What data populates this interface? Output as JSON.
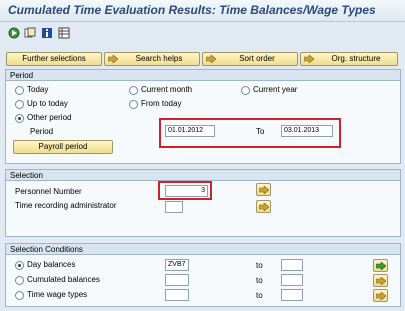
{
  "title": "Cumulated Time Evaluation Results: Time Balances/Wage Types",
  "toolbar": {
    "icons": [
      "execute-icon",
      "variant-icon",
      "info-icon",
      "layout-icon"
    ],
    "buttons": [
      {
        "label": "Further selections"
      },
      {
        "label": "Search helps"
      },
      {
        "label": "Sort order"
      },
      {
        "label": "Org. structure"
      }
    ]
  },
  "period": {
    "header": "Period",
    "options": {
      "today": "Today",
      "current_month": "Current month",
      "current_year": "Current year",
      "up_to_today": "Up to today",
      "from_today": "From today",
      "other_period": "Other period"
    },
    "selected": "other_period",
    "period_label": "Period",
    "from_date": "01.01.2012",
    "to_label": "To",
    "to_date": "03.01.2013",
    "payroll_button": "Payroll period"
  },
  "selection": {
    "header": "Selection",
    "personnel_label": "Personnel Number",
    "personnel_value": "3",
    "time_admin_label": "Time recording administrator",
    "time_admin_value": ""
  },
  "conditions": {
    "header": "Selection Conditions",
    "rows": [
      {
        "label": "Day balances",
        "value": "ZVB7",
        "to_label": "to",
        "to_value": "",
        "selected": true
      },
      {
        "label": "Cumulated balances",
        "value": "",
        "to_label": "to",
        "to_value": "",
        "selected": false
      },
      {
        "label": "Time wage types",
        "value": "",
        "to_label": "to",
        "to_value": "",
        "selected": false
      }
    ]
  },
  "colors": {
    "accent_red": "#d0212c",
    "title_blue": "#2a4a7a",
    "button_yellow": "#f0dc8d"
  }
}
